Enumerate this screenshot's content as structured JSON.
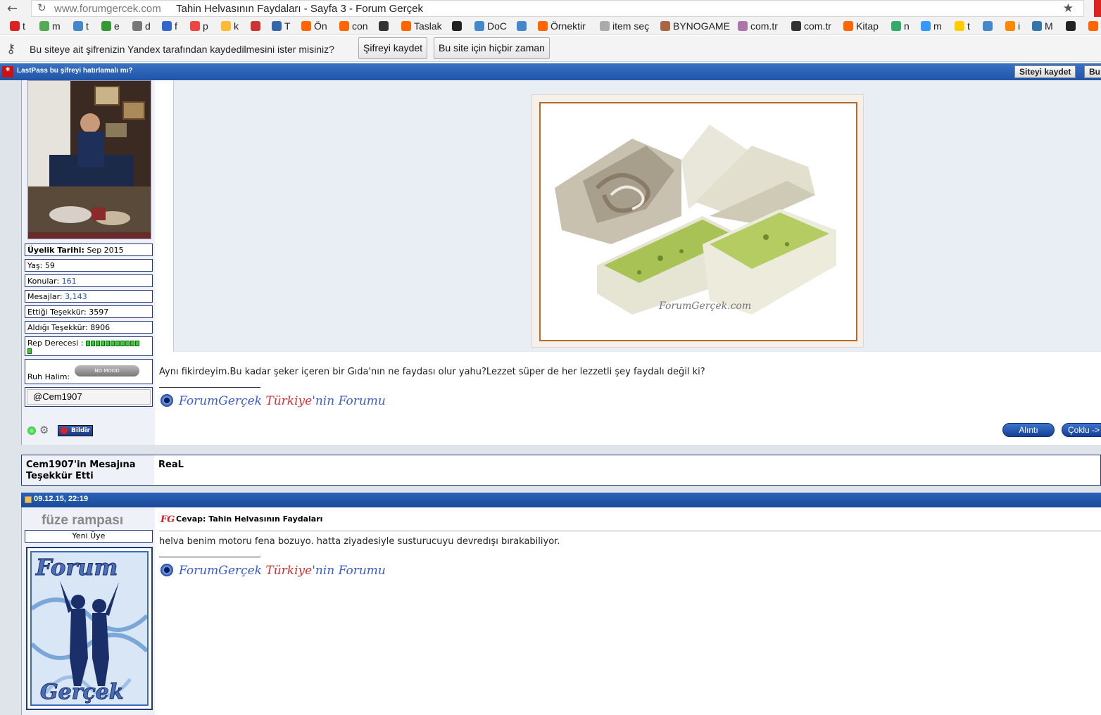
{
  "browser": {
    "url": "www.forumgercek.com",
    "tab_title": "Tahin Helvasının Faydaları - Sayfa 3 - Forum Gerçek",
    "bookmarks": [
      {
        "label": "t",
        "color": "#d22"
      },
      {
        "label": "m",
        "color": "#5a5"
      },
      {
        "label": "t",
        "color": "#48c"
      },
      {
        "label": "e",
        "color": "#393"
      },
      {
        "label": "d",
        "color": "#777"
      },
      {
        "label": "f",
        "color": "#36c"
      },
      {
        "label": "p",
        "color": "#e44"
      },
      {
        "label": "k",
        "color": "#fb3"
      },
      {
        "label": "",
        "color": "#c33"
      },
      {
        "label": "T",
        "color": "#36a"
      },
      {
        "label": "Ön",
        "color": "#f60"
      },
      {
        "label": "con",
        "color": "#f60"
      },
      {
        "label": "",
        "color": "#333"
      },
      {
        "label": "Taslak",
        "color": "#f60"
      },
      {
        "label": "",
        "color": "#222"
      },
      {
        "label": "DoC",
        "color": "#48c"
      },
      {
        "label": "",
        "color": "#48c"
      },
      {
        "label": "Örnektir",
        "color": "#f60"
      },
      {
        "label": "item seç",
        "color": "#aaa"
      },
      {
        "label": "BYNOGAME",
        "color": "#a64"
      },
      {
        "label": "com.tr",
        "color": "#a7a"
      },
      {
        "label": "com.tr",
        "color": "#333"
      },
      {
        "label": "Kitap",
        "color": "#f60"
      },
      {
        "label": "n",
        "color": "#3a6"
      },
      {
        "label": "m",
        "color": "#39f"
      },
      {
        "label": "t",
        "color": "#fc0"
      },
      {
        "label": "",
        "color": "#48c"
      },
      {
        "label": "i",
        "color": "#f80"
      },
      {
        "label": "M",
        "color": "#37a"
      },
      {
        "label": "",
        "color": "#222"
      },
      {
        "label": "",
        "color": "#f60"
      }
    ]
  },
  "infobar": {
    "message": "Bu siteye ait şifrenizin Yandex tarafından kaydedilmesini ister misiniz?",
    "save_label": "Şifreyi kaydet",
    "never_label": "Bu site için hiçbir zaman"
  },
  "lastpass": {
    "message": "LastPass bu şifreyi hatırlamalı mı?",
    "save_site_label": "Siteyi kaydet",
    "other_label": "Bu"
  },
  "post1": {
    "member": {
      "join_label": "Üyelik Tarihi:",
      "join_value": "Sep 2015",
      "age_label": "Yaş:",
      "age_value": "59",
      "topics_label": "Konular:",
      "topics_value": "161",
      "messages_label": "Mesajlar:",
      "messages_value": "3,143",
      "thanks_given_label": "Ettiği Teşekkür:",
      "thanks_given_value": "3597",
      "thanks_received_label": "Aldığı Teşekkür:",
      "thanks_received_value": "8906",
      "rep_label": "Rep Derecesi :",
      "rep_segments": 12,
      "mood_label": "Ruh Halim:",
      "mood_value": "NO MOOD",
      "handle": "@Cem1907",
      "report_label": "Bildir"
    },
    "image_watermark": "ForumGerçek.com",
    "text": "Aynı fikirdeyim.Bu kadar şeker içeren bir Gıda'nın ne faydası olur yahu?Lezzet süper de her lezzetli şey faydalı değil ki?",
    "signature": {
      "part1": "ForumGerçek ",
      "part2": "Türkiye",
      "part3": "'nin Forumu"
    },
    "quote_label": "Alıntı",
    "multi_label": "Çoklu ->"
  },
  "thanks": {
    "title_line1": "Cem1907'in Mesajına",
    "title_line2": "Teşekkür Etti",
    "users": "ReaL"
  },
  "post2": {
    "datetime": "09.12.15, 22:19",
    "username": "füze rampası",
    "rank": "Yeni Üye",
    "avatar_top": "Forum",
    "avatar_bottom": "Gerçek",
    "title": "Cevap: Tahin Helvasının Faydaları",
    "text": "helva benim motoru fena bozuyo. hatta ziyadesiyle susturucuyu devredışı bırakabiliyor.",
    "signature": {
      "part1": "ForumGerçek ",
      "part2": "Türkiye",
      "part3": "'nin Forumu"
    }
  }
}
